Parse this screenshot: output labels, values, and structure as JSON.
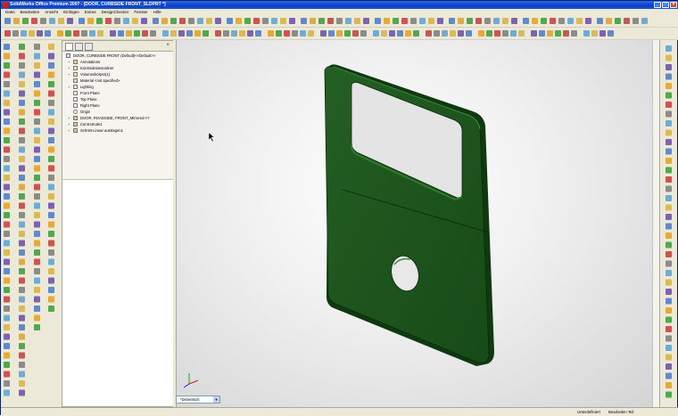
{
  "window": {
    "title": "SolidWorks Office Premium 2007 - [DOOR, CURBSIDE FRONT_SLDPRT *]"
  },
  "menu": [
    "Datei",
    "Bearbeiten",
    "Ansicht",
    "Einfügen",
    "Extras",
    "DesignChecker",
    "Fenster",
    "Hilfe"
  ],
  "feature_tree": {
    "items": [
      {
        "label": "DOOR, CURBSIDE FRONT  (Default)<<Default>>",
        "level": 0
      },
      {
        "label": "Annotations",
        "level": 1
      },
      {
        "label": "Konstruktionsordner",
        "level": 1
      },
      {
        "label": "Volumenkörper(1)",
        "level": 1
      },
      {
        "label": "Material <not specified>",
        "level": 1
      },
      {
        "label": "Lighting",
        "level": 1
      },
      {
        "label": "Front Plane",
        "level": 1
      },
      {
        "label": "Top Plane",
        "level": 1
      },
      {
        "label": "Right Plane",
        "level": 1
      },
      {
        "label": "Origin",
        "level": 1
      },
      {
        "label": "DOOR, ROADSIDE, FRONT_Mirrored->?",
        "level": 1
      },
      {
        "label": "Cut-Extrude1",
        "level": 1
      },
      {
        "label": "Schnitt-Linear austragen1",
        "level": 1
      }
    ]
  },
  "view": {
    "orientation": "*Dimetrisch"
  },
  "status": {
    "left": "",
    "state": "Unterdefiniert",
    "mode": "Bearbeiten Teil"
  },
  "colors": {
    "part": "#1f5a1f",
    "part_edge": "#0e3010",
    "titlebar": "#0a3fc4"
  }
}
